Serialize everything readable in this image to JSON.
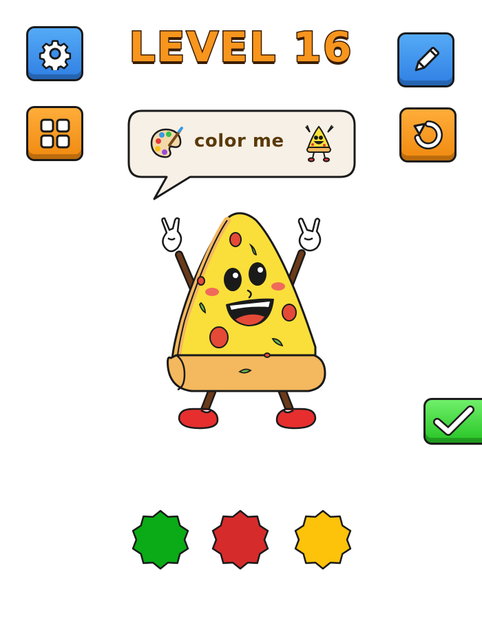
{
  "level": {
    "title": "LEVEL 16"
  },
  "hint": {
    "text": "color me"
  },
  "toolbar": {
    "settings_icon": "gear-icon",
    "levels_icon": "grid-icon",
    "edit_icon": "pencil-icon",
    "restart_icon": "restart-icon",
    "confirm_icon": "checkmark-icon"
  },
  "palette": {
    "colors": [
      "#0aab16",
      "#d62b2b",
      "#fdc20a"
    ]
  }
}
